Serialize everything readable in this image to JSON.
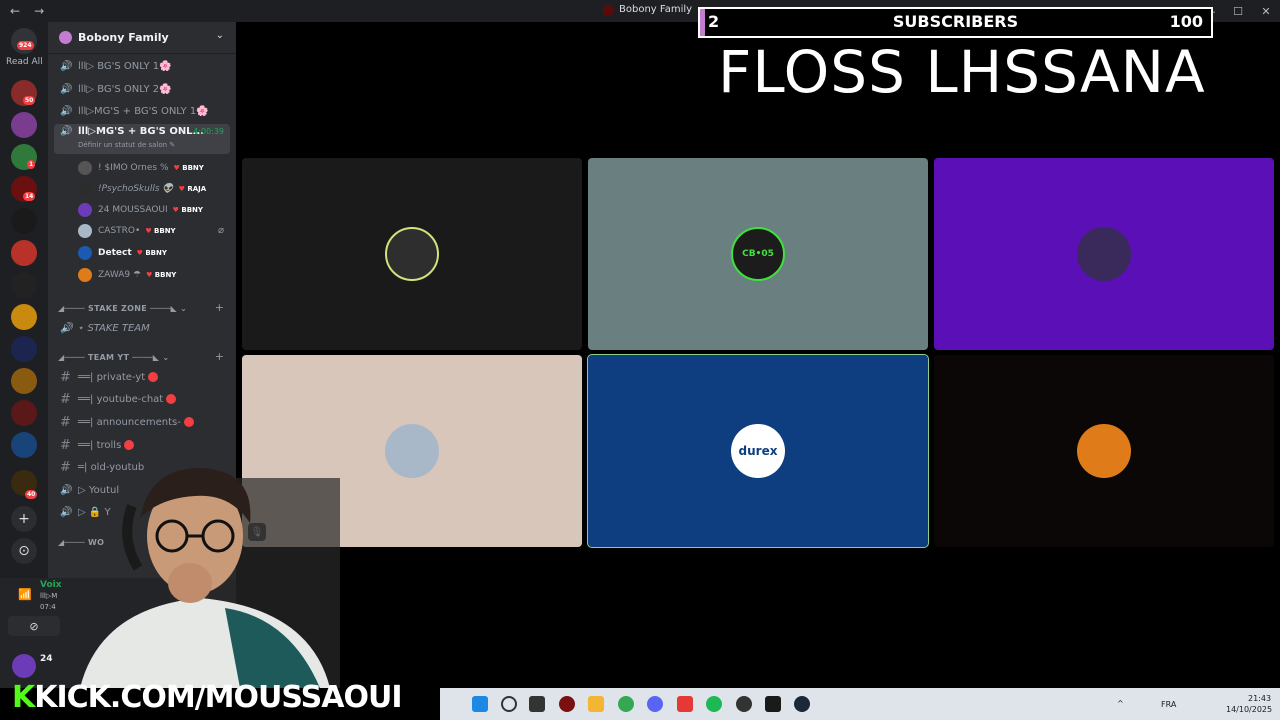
{
  "window": {
    "title": "Bobony Family",
    "back": "←",
    "forward": "→",
    "min": "—",
    "max": "☐",
    "close": "✕"
  },
  "servers": {
    "readall": "Read All",
    "home_badge": "924",
    "badges": [
      "50",
      "1",
      "14",
      "40"
    ],
    "add": "+",
    "explore": "⊙"
  },
  "server": {
    "name": "Bobony Family",
    "chevron": "⌄"
  },
  "channels": [
    {
      "label": "lll▷ BG'S ONLY 1🌸",
      "icon": "🔊"
    },
    {
      "label": "lll▷ BG'S ONLY 2🌸",
      "icon": "🔊"
    },
    {
      "label": "lll▷MG'S + BG'S ONLY 1🌸",
      "icon": "🔊"
    }
  ],
  "active_channel": {
    "label": "lll▷MG'S + BG'S ONL...",
    "timer": "4:00:39",
    "status": "Définir un statut de salon ✎",
    "icon": "🔊"
  },
  "members": [
    {
      "name": "! $IMO Ornes %",
      "tag": "BBNY"
    },
    {
      "name": "!PsychoSkulls 👽",
      "tag": "RAJA"
    },
    {
      "name": "24 MOUSSAOUI",
      "tag": "BBNY"
    },
    {
      "name": "CASTRO•",
      "tag": "BBNY"
    },
    {
      "name": "Detect",
      "tag": "BBNY"
    },
    {
      "name": "ZAWA9 ☂",
      "tag": "BBNY"
    }
  ],
  "categories": {
    "stake": "◢──── STAKE ZONE ────◣",
    "stake_chevron": "⌄",
    "stake_channel": "⋆ STAKE TEAM",
    "team": "◢──── TEAM YT ────◣",
    "team_chevron": "⌄",
    "plus": "+",
    "wo": "◢──── WO"
  },
  "team_channels": [
    {
      "label": "══| private-yt",
      "icon": "#"
    },
    {
      "label": "══| youtube-chat",
      "icon": "#"
    },
    {
      "label": "══| announcements-",
      "icon": "#"
    },
    {
      "label": "══| trolls",
      "icon": "#"
    },
    {
      "label": "═| old-youtub",
      "icon": "#"
    },
    {
      "label": "▷ Youtul",
      "icon": "🔊"
    },
    {
      "label": "▷ 🔒 Y",
      "icon": "🔊"
    }
  ],
  "voice": {
    "connected": "Voix",
    "server": "lll▷M",
    "time": "07:4",
    "mute_icon": "⊘",
    "signal": "📶",
    "user_short": "24"
  },
  "subscribers": {
    "current": "2",
    "label": "SUBSCRIBERS",
    "goal": "100"
  },
  "overlay_title": "FLOSS LHSSANA",
  "tiles": [
    {
      "bg": "#1a1a1a",
      "avatar": "#2e2e2e",
      "text": ""
    },
    {
      "bg": "#6a7f80",
      "avatar": "#1c1c1c",
      "text": "CB•05"
    },
    {
      "bg": "#5a10b6",
      "avatar": "#3a2a5c",
      "text": ""
    },
    {
      "bg": "#d7c6b9",
      "avatar": "#a8b8c8",
      "text": ""
    },
    {
      "bg": "#0e3e80",
      "avatar": "#ffffff",
      "text": "durex"
    },
    {
      "bg": "#0b0707",
      "avatar": "#e07b1a",
      "text": ""
    }
  ],
  "tile_mute_icon": "🎙",
  "stream": {
    "kick_k": "K",
    "kick_rest": "KICK.COM/MOUSSAOUI"
  },
  "tray": {
    "lang": "FRA",
    "time": "21:43",
    "date": "14/10/2025",
    "chevron": "^"
  }
}
